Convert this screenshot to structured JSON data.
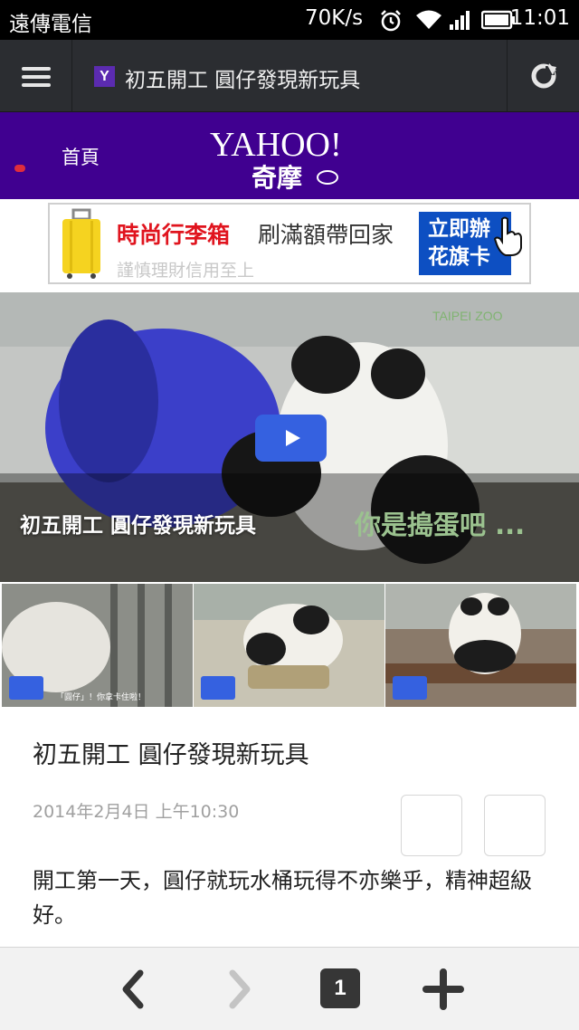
{
  "status_bar": {
    "carrier": "遠傳電信",
    "speed": "70K/s",
    "time": "11:01",
    "icons": [
      "alarm-icon",
      "wifi-icon",
      "signal-icon",
      "battery-icon"
    ]
  },
  "browser": {
    "favicon_letter": "Y",
    "tab_title": "初五開工 圓仔發現新玩具",
    "icons": [
      "hamburger-menu-icon",
      "reload-icon"
    ]
  },
  "site_header": {
    "home_label": "首頁",
    "logo_text": "YAHOO!",
    "logo_sub": "奇摩",
    "brand_color": "#400090"
  },
  "ad": {
    "headline": "時尚行李箱",
    "headline2": "刷滿額帶回家",
    "subline": "謹慎理財信用至上",
    "button_line1": "立即辦",
    "button_line2": "花旗卡"
  },
  "hero_video": {
    "caption": "初五開工 圓仔發現新玩具",
    "subtitle": "你是搗蛋吧 ...",
    "watermark": "TAIPEI ZOO"
  },
  "thumbnails": [
    {
      "caption": "「圓仔」！你拿卡住啦！"
    },
    {
      "caption": ""
    },
    {
      "caption": ""
    }
  ],
  "article": {
    "title": "初五開工 圓仔發現新玩具",
    "date": "2014年2月4日 上午10:30",
    "body": "開工第一天，圓仔就玩水桶玩得不亦樂乎，精神超級好。"
  },
  "toolbar": {
    "tab_count": "1",
    "icons": [
      "back-icon",
      "forward-icon",
      "tabs-icon",
      "new-tab-icon"
    ]
  }
}
